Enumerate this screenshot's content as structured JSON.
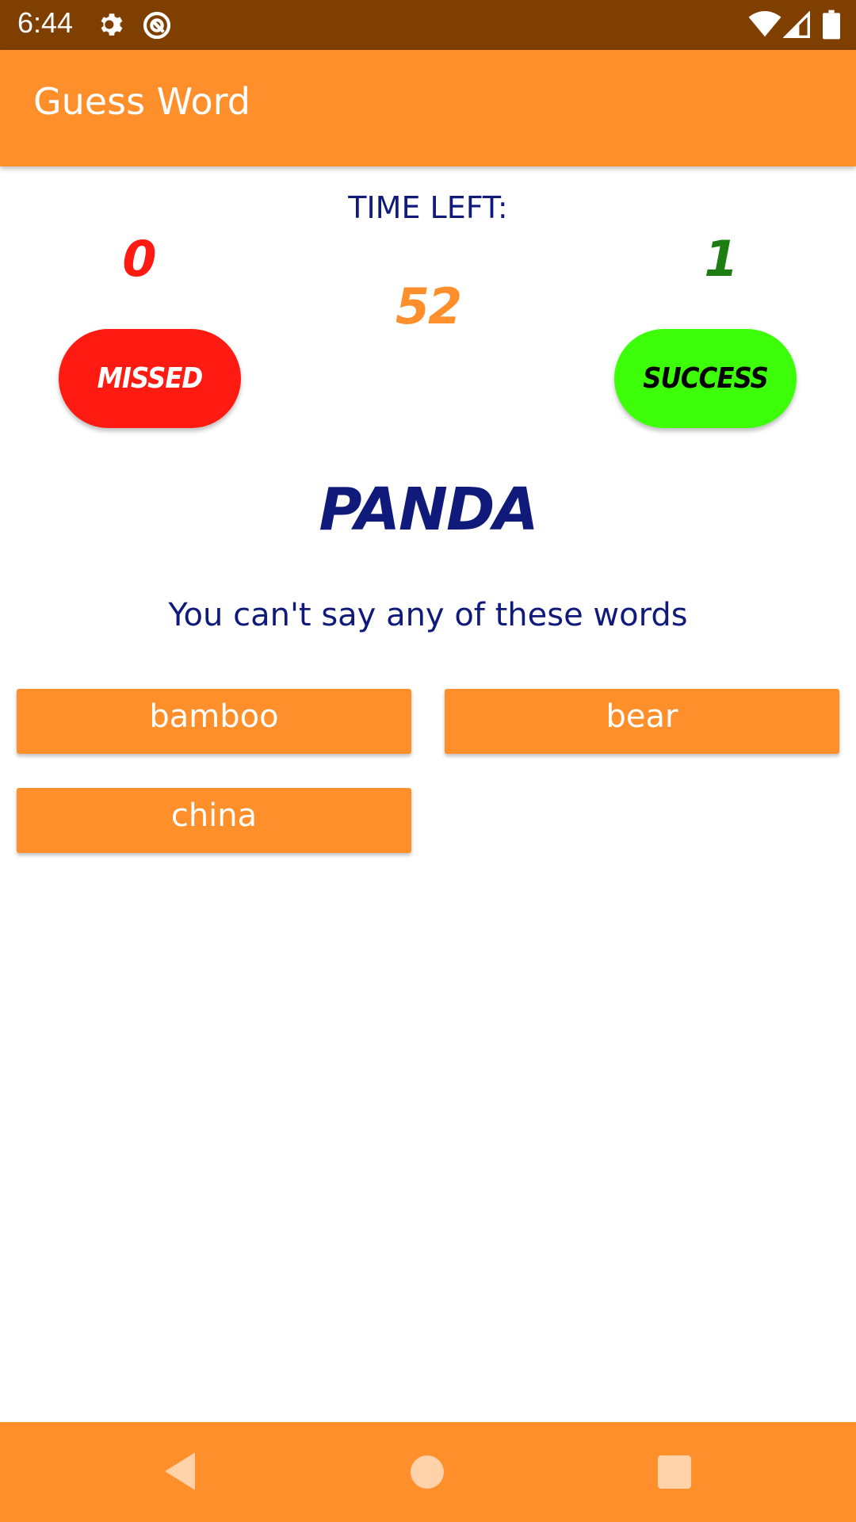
{
  "status_bar": {
    "time": "6:44",
    "icons": [
      "settings-icon",
      "vpn-icon",
      "wifi-icon",
      "signal-icon",
      "battery-icon"
    ]
  },
  "app_bar": {
    "title": "Guess Word"
  },
  "game": {
    "time_left_label": "TIME LEFT:",
    "timer_value": "52",
    "missed_count": "0",
    "success_count": "1",
    "missed_label": "MISSED",
    "success_label": "SUCCESS",
    "target_word": "PANDA",
    "instructions": "You can't say any of these words",
    "forbidden_words": [
      "bamboo",
      "bear",
      "china"
    ]
  },
  "nav": {
    "icons": [
      "back-icon",
      "home-icon",
      "recents-icon"
    ]
  },
  "colors": {
    "status_bar": "#7f3f00",
    "accent": "#ff8f2b",
    "missed": "#ff1a12",
    "success": "#3dff0a",
    "success_count": "#1c7d10",
    "text_dark": "#0f1a7a"
  }
}
